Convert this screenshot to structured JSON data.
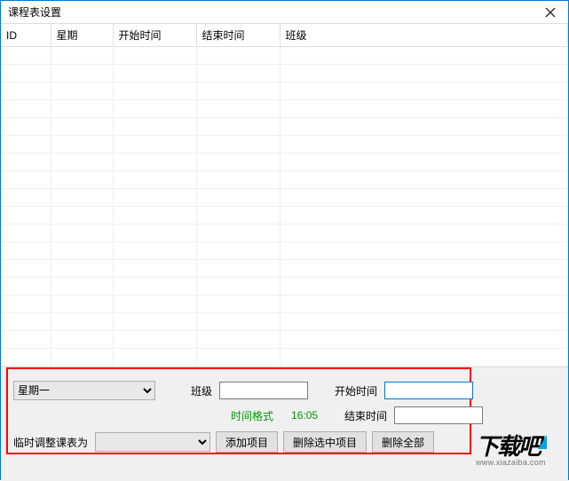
{
  "window": {
    "title": "课程表设置"
  },
  "table": {
    "columns": [
      "ID",
      "星期",
      "开始时间",
      "结束时间",
      "班级"
    ]
  },
  "form": {
    "weekday_selected": "星期一",
    "class_label": "班级",
    "class_value": "",
    "start_label": "开始时间",
    "start_value": "",
    "end_label": "结束时间",
    "end_value": "",
    "time_format_label": "时间格式",
    "time_format_example": "16:05",
    "temp_adjust_label": "临时调整课表为",
    "temp_adjust_value": "",
    "btn_add": "添加项目",
    "btn_delete_selected": "删除选中项目",
    "btn_delete_all": "删除全部"
  },
  "watermark": {
    "logo_text": "下载吧",
    "url": "www.xiazaiba.com"
  }
}
